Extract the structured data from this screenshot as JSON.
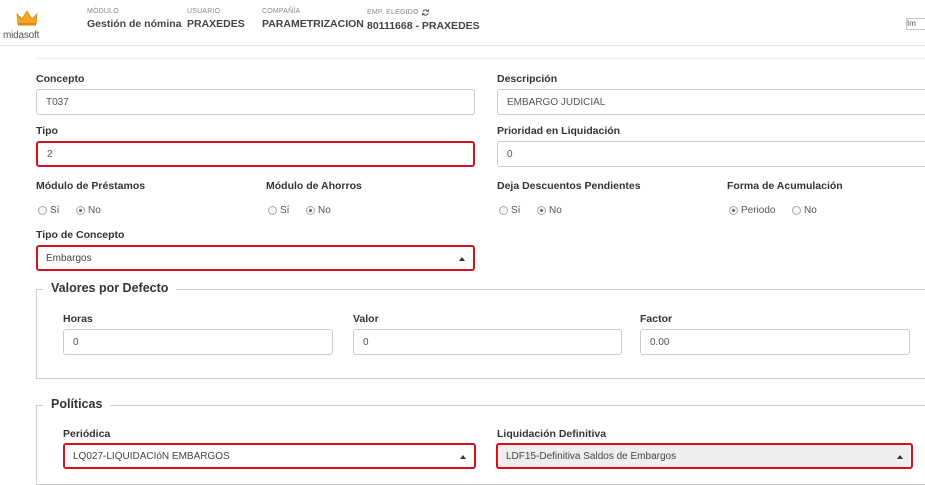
{
  "header": {
    "brand": "midasoft",
    "modulo_label": "MÓDULO",
    "modulo_value": "Gestión de nómina",
    "usuario_label": "USUARIO",
    "usuario_value": "PRAXEDES",
    "compania_label": "COMPAÑÍA",
    "compania_value": "PARAMETRIZACION",
    "emp_label": "EMP. ELEGIDO",
    "emp_value": "80111668 - PRAXEDES",
    "broken_image_alt": "Im",
    "crown_color": "#f5a623"
  },
  "form": {
    "concepto_label": "Concepto",
    "concepto_value": "T037",
    "descripcion_label": "Descripción",
    "descripcion_value": "EMBARGO JUDICIAL",
    "tipo_label": "Tipo",
    "tipo_value": "2",
    "prioridad_label": "Prioridad en Liquidación",
    "prioridad_value": "0",
    "prestamos_label": "Módulo de Préstamos",
    "ahorros_label": "Módulo de Ahorros",
    "descuentos_label": "Deja Descuentos Pendientes",
    "acumulacion_label": "Forma de Acumulación",
    "opt_si": "Sí",
    "opt_no": "No",
    "opt_periodo": "Periodo",
    "tipo_concepto_label": "Tipo de Concepto",
    "tipo_concepto_value": "Embargos"
  },
  "valores": {
    "legend": "Valores por Defecto",
    "horas_label": "Horas",
    "horas_value": "0",
    "valor_label": "Valor",
    "valor_value": "0",
    "factor_label": "Factor",
    "factor_value": "0.00"
  },
  "politicas": {
    "legend": "Políticas",
    "periodica_label": "Periódica",
    "periodica_value": "LQ027-LIQUIDACIóN EMBARGOS",
    "liquidacion_label": "Liquidación Definitiva",
    "liquidacion_value": "LDF15-Definitiva Saldos de Embargos"
  },
  "colors": {
    "highlight": "#d6111b"
  }
}
